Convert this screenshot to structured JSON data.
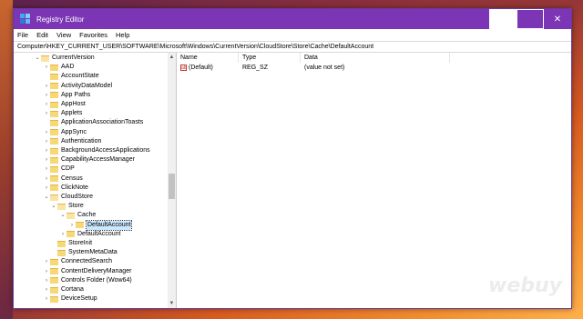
{
  "window": {
    "title": "Registry Editor"
  },
  "menu": [
    "File",
    "Edit",
    "View",
    "Favorites",
    "Help"
  ],
  "address": "Computer\\HKEY_CURRENT_USER\\SOFTWARE\\Microsoft\\Windows\\CurrentVersion\\CloudStore\\Store\\Cache\\DefaultAccount",
  "tree": [
    {
      "label": "CurrentVersion",
      "chev": "⌄"
    },
    {
      "label": "AAD",
      "chev": "›"
    },
    {
      "label": "AccountState",
      "chev": ""
    },
    {
      "label": "ActivityDataModel",
      "chev": "›"
    },
    {
      "label": "App Paths",
      "chev": "›"
    },
    {
      "label": "AppHost",
      "chev": "›"
    },
    {
      "label": "Applets",
      "chev": "›"
    },
    {
      "label": "ApplicationAssociationToasts",
      "chev": ""
    },
    {
      "label": "AppSync",
      "chev": "›"
    },
    {
      "label": "Authentication",
      "chev": "›"
    },
    {
      "label": "BackgroundAccessApplications",
      "chev": "›"
    },
    {
      "label": "CapabilityAccessManager",
      "chev": "›"
    },
    {
      "label": "CDP",
      "chev": "›"
    },
    {
      "label": "Census",
      "chev": "›"
    },
    {
      "label": "ClickNote",
      "chev": "›"
    },
    {
      "label": "CloudStore",
      "chev": "⌄"
    },
    {
      "label": "Store",
      "chev": "⌄"
    },
    {
      "label": "Cache",
      "chev": "⌄"
    },
    {
      "label": "DefaultAccount",
      "chev": "›"
    },
    {
      "label": "DefaultAccount",
      "chev": "›"
    },
    {
      "label": "StoreInit",
      "chev": ""
    },
    {
      "label": "SystemMetaData",
      "chev": ""
    },
    {
      "label": "ConnectedSearch",
      "chev": "›"
    },
    {
      "label": "ContentDeliveryManager",
      "chev": "›"
    },
    {
      "label": "Controls Folder (Wow64)",
      "chev": "›"
    },
    {
      "label": "Cortana",
      "chev": "›"
    },
    {
      "label": "DeviceSetup",
      "chev": "›"
    }
  ],
  "columns": {
    "name": "Name",
    "type": "Type",
    "data": "Data"
  },
  "values": [
    {
      "name": "(Default)",
      "type": "REG_SZ",
      "data": "(value not set)"
    }
  ],
  "watermark": "webuy"
}
